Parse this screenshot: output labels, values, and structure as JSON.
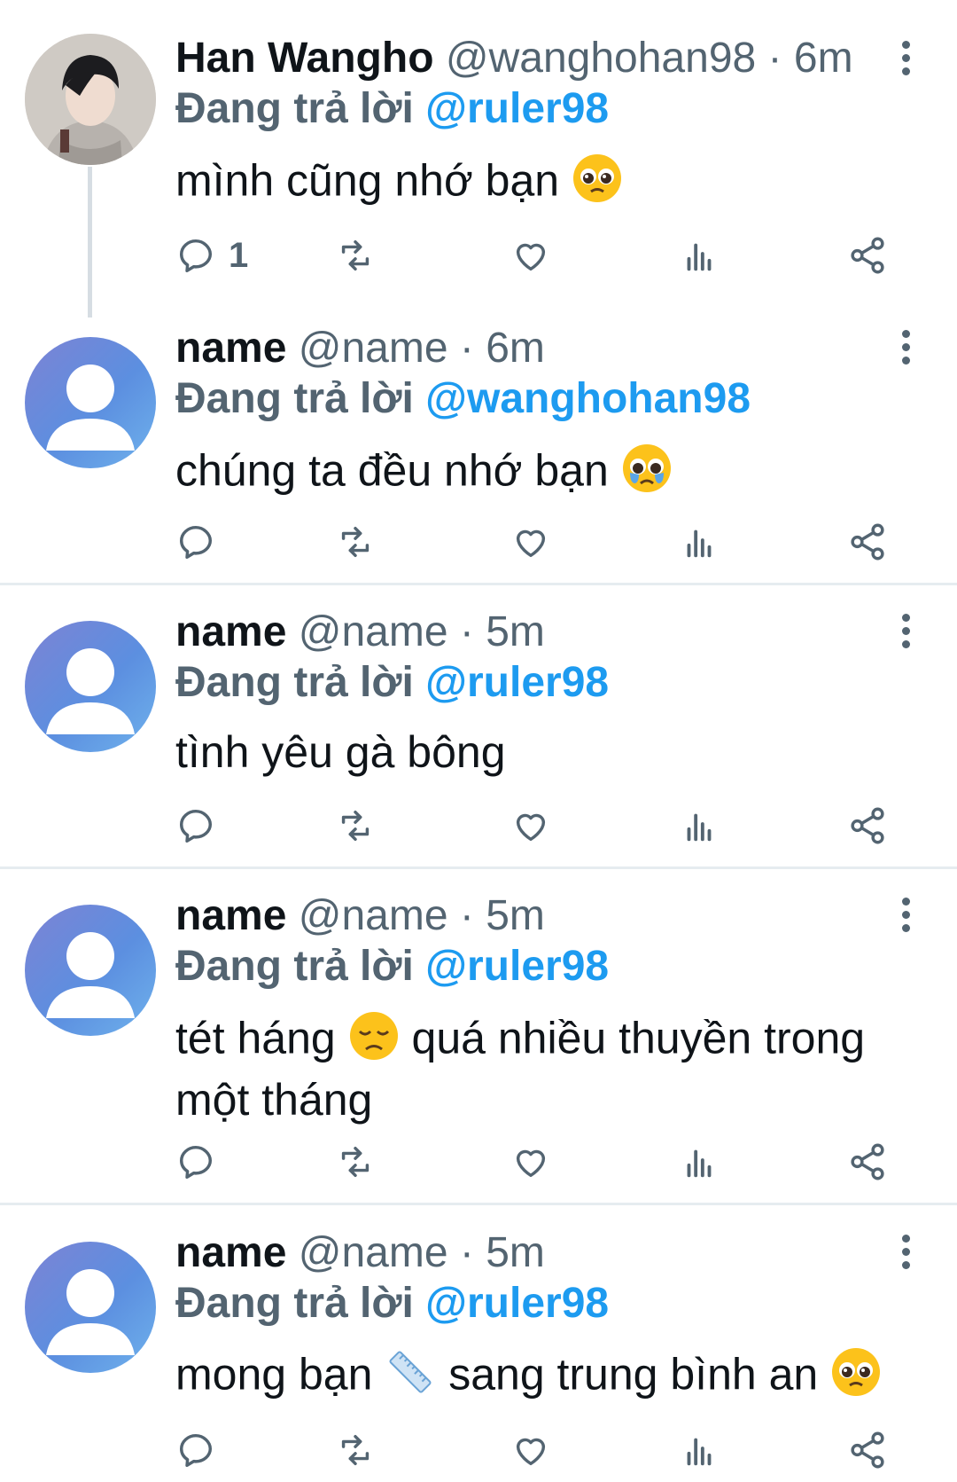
{
  "tweets": [
    {
      "name": "Han Wangho",
      "handle": "@wanghohan98",
      "time": "· 6m",
      "reply_label": "Đang trả lời",
      "reply_to": "@ruler98",
      "text_a": "mình cũng nhớ bạn",
      "text_b": "",
      "emoji": "pleading-face",
      "reply_count": "1"
    },
    {
      "name": "name",
      "handle": "@name",
      "time": "· 6m",
      "reply_label": "Đang trả lời",
      "reply_to": "@wanghohan98",
      "text_a": "chúng ta đều nhớ bạn",
      "text_b": "",
      "emoji": "crying-pleading-face",
      "reply_count": ""
    },
    {
      "name": "name",
      "handle": "@name",
      "time": "· 5m",
      "reply_label": "Đang trả lời",
      "reply_to": "@ruler98",
      "text_a": "tình yêu gà bông",
      "text_b": "",
      "emoji": "",
      "reply_count": ""
    },
    {
      "name": "name",
      "handle": "@name",
      "time": "· 5m",
      "reply_label": "Đang trả lời",
      "reply_to": "@ruler98",
      "text_a": "tét háng",
      "text_b": "quá nhiều thuyền trong một tháng",
      "emoji": "disappointed-face",
      "reply_count": ""
    },
    {
      "name": "name",
      "handle": "@name",
      "time": "· 5m",
      "reply_label": "Đang trả lời",
      "reply_to": "@ruler98",
      "text_a": "mong bạn",
      "text_b": "sang trung bình an",
      "emoji": "ruler-emoji, pleading-face",
      "reply_count": ""
    }
  ],
  "icons": [
    "reply-icon",
    "retweet-icon",
    "like-icon",
    "analytics-icon",
    "share-icon",
    "more-icon"
  ],
  "colors": {
    "mention": "#1d9bf0",
    "secondary": "#536471",
    "text": "#0f1419",
    "divider": "#e6ecf0"
  }
}
